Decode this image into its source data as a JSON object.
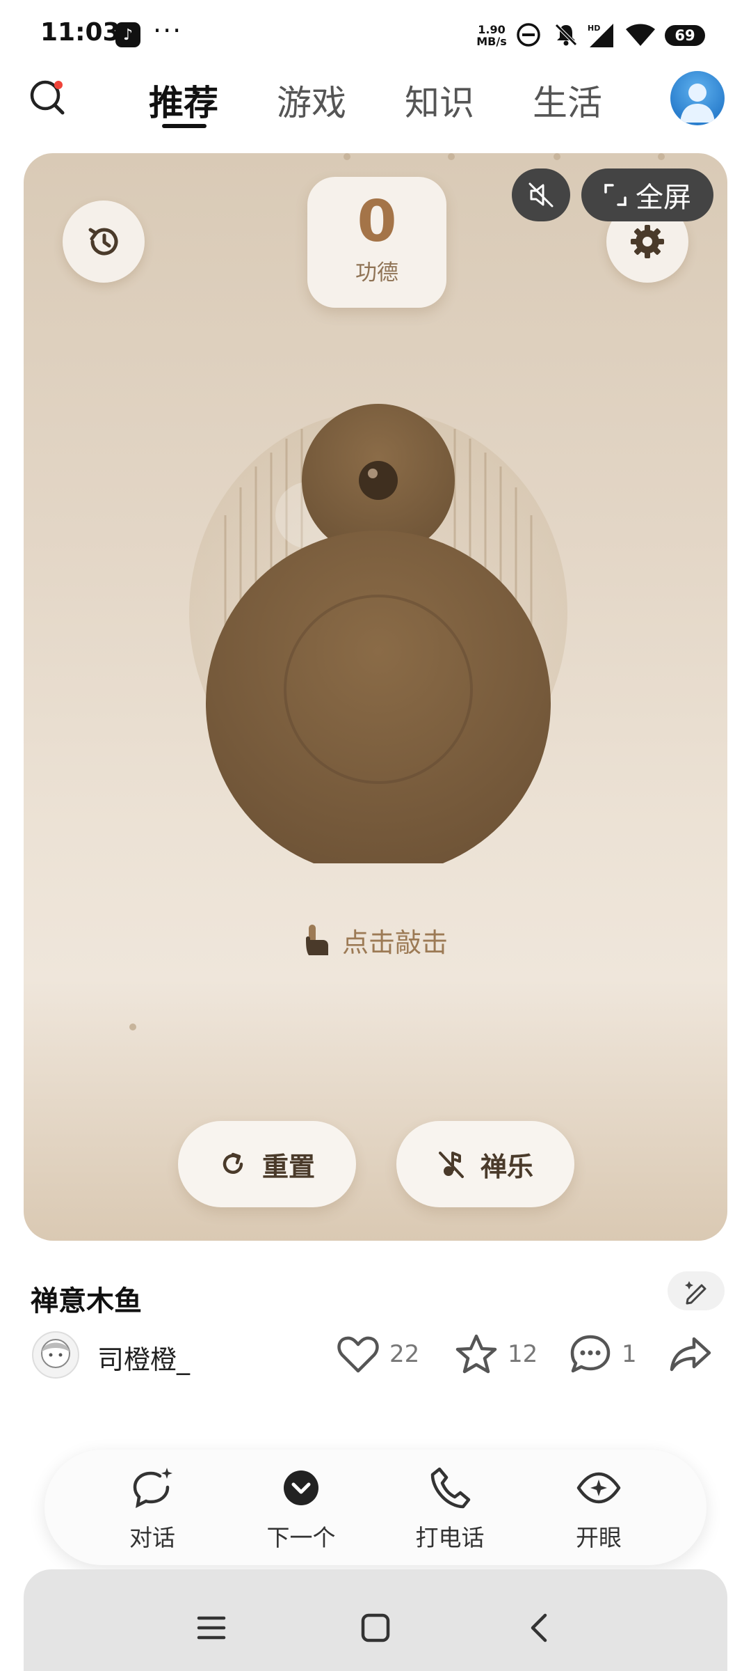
{
  "status_bar": {
    "time": "11:03",
    "app_icon": "tiktok-icon",
    "more": "···",
    "net_speed_value": "1.90",
    "net_speed_unit": "MB/s",
    "battery": "69",
    "icons": [
      "do-not-disturb-icon",
      "bell-muted-icon",
      "hd-signal-icon",
      "wifi-icon"
    ]
  },
  "top_nav": {
    "tabs": [
      {
        "label": "推荐",
        "active": true
      },
      {
        "label": "游戏",
        "active": false
      },
      {
        "label": "知识",
        "active": false
      },
      {
        "label": "生活",
        "active": false
      }
    ]
  },
  "card": {
    "merit": {
      "count": "0",
      "label": "功德"
    },
    "fullscreen_label": "全屏",
    "tap_hint": "点击敲击",
    "reset_label": "重置",
    "music_label": "禅乐"
  },
  "post": {
    "title": "禅意木鱼",
    "author": "司橙橙_",
    "likes": "22",
    "favorites": "12",
    "comments": "1"
  },
  "action_bar": {
    "items": [
      {
        "label": "对话",
        "icon": "chat-sparkle-icon"
      },
      {
        "label": "下一个",
        "icon": "chevron-down-circle-icon"
      },
      {
        "label": "打电话",
        "icon": "phone-icon"
      },
      {
        "label": "开眼",
        "icon": "eye-sparkle-icon"
      }
    ]
  },
  "colors": {
    "accent": "#a47448",
    "card_bg": "#e3d6c6",
    "fish": "#7d6140"
  }
}
